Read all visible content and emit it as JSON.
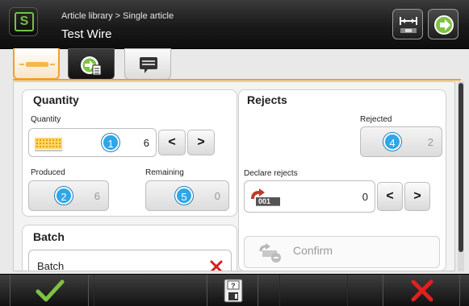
{
  "header": {
    "breadcrumb": "Article library > Single article",
    "title": "Test Wire",
    "app_icon": "s-logo-icon",
    "buttons": [
      "width-measure-icon",
      "arrow-next-icon"
    ]
  },
  "tabs": [
    {
      "icon": "wire-icon",
      "active": true
    },
    {
      "icon": "settings-list-icon",
      "active": false
    },
    {
      "icon": "note-icon",
      "active": false
    }
  ],
  "quantity": {
    "title": "Quantity",
    "quantity_label": "Quantity",
    "quantity_badge": "1",
    "quantity_value": "6",
    "produced_label": "Produced",
    "produced_badge": "2",
    "produced_value": "6",
    "remaining_label": "Remaining",
    "remaining_badge": "5",
    "remaining_value": "0"
  },
  "rejects": {
    "title": "Rejects",
    "rejected_label": "Rejected",
    "rejected_badge": "4",
    "rejected_value": "2",
    "declare_label": "Declare rejects",
    "declare_icon_text": "001",
    "declare_value": "0",
    "confirm_label": "Confirm"
  },
  "batch": {
    "title": "Batch",
    "field_label": "Batch"
  },
  "colors": {
    "accent": "#f0a028",
    "badge": "#2ea6e8",
    "ok": "#7ec242",
    "cancel": "#e02020"
  }
}
